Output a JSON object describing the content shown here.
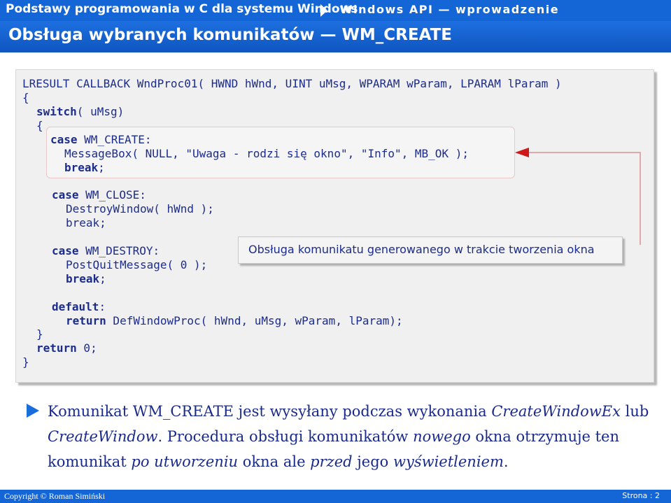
{
  "header": {
    "course": "Podstawy programowania w C dla systemu Windows",
    "section": "Windows API — wprowadzenie"
  },
  "title": "Obsługa wybranych komunikatów — WM_CREATE",
  "code": {
    "line1": "LRESULT CALLBACK WndProc01( HWND hWnd, UINT uMsg, WPARAM wParam, LPARAM lParam )",
    "line2": "{",
    "line3_kw": "switch",
    "line3_rest": "( uMsg)",
    "line4": "{",
    "line5_kw": "case",
    "line5_rest": " WM_CREATE:",
    "line6": "MessageBox( NULL, \"Uwaga - rodzi się okno\", \"Info\", MB_OK );",
    "line7_kw": "break",
    "line7_rest": ";",
    "line8_kw": "case",
    "line8_rest": " WM_CLOSE:",
    "line9": "DestroyWindow( hWnd );",
    "line10": "break;",
    "line11_kw": "case",
    "line11_rest": " WM_DESTROY:",
    "line12": "PostQuitMessage( 0 );",
    "line13_kw": "break",
    "line13_rest": ";",
    "line14_kw": "default",
    "line14_rest": ":",
    "line15_kw": "return",
    "line15_rest": " DefWindowProc( hWnd, uMsg, wParam, lParam);",
    "line16": "}",
    "line17_kw": "return",
    "line17_rest": " 0;",
    "line18": "}"
  },
  "callout": "Obsługa komunikatu generowanego w trakcie tworzenia okna",
  "paragraph": {
    "p1": "Komunikat WM_CREATE jest wysyłany podczas wykonania ",
    "p1_i": "CreateWindowEx",
    "p2": " lub ",
    "p2_i": "CreateWindow",
    "p3": ". Procedura obsługi komunikatów ",
    "p3_i": "nowego",
    "p4": " okna otrzymuje ten komunikat ",
    "p4_i": "po utworzeniu",
    "p5": " okna ale ",
    "p5_i": "przed",
    "p6": " jego ",
    "p6_i": "wyświetleniem",
    "p7": "."
  },
  "footer": {
    "copyright": "Copyright © Roman Simiński",
    "page": "Strona :  2"
  },
  "colors": {
    "accent": "#1466d6",
    "code_text": "#1c2c8c",
    "arrow": "#d01818"
  }
}
